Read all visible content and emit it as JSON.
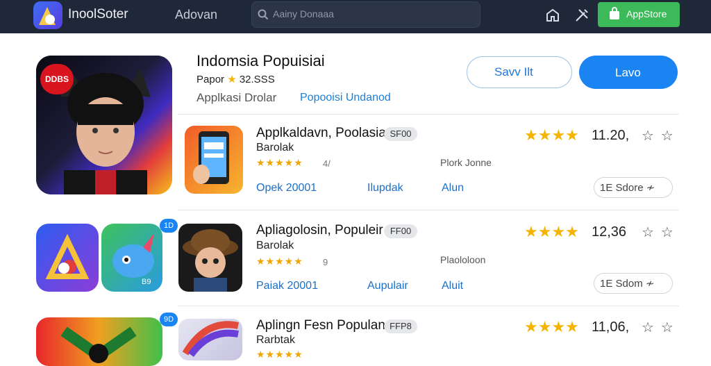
{
  "header": {
    "brand": "InoolSoter",
    "nav_link": "Adovan",
    "search_placeholder": "Aainy Donaaa",
    "appstore_label": "AppStore"
  },
  "hero": {
    "title": "Indomsia Popuisiai",
    "subtitle_prefix": "Papor",
    "subtitle_rating": "32.SSS",
    "category": "Applkasi Drolar",
    "category_link": "Popooisi Undanod",
    "secondary_button": "Savv   Ilt",
    "primary_button": "Lavo",
    "badge_text": "DDBS"
  },
  "list": [
    {
      "title": "Applkaldavn, Poolasia",
      "subtitle": "Barolak",
      "badge": "SF00",
      "mini_stars": "★★★★★",
      "mini_count": "4/",
      "developer": "Plork Jonne",
      "meta_left": "Opek 20001",
      "meta_mid": "Ilupdak",
      "meta_right": "Alun",
      "stars": "★★★★",
      "rating": "11.20,",
      "outline_stars": "☆☆",
      "pill": "1E Sdore ≁"
    },
    {
      "title": "Apliagolosin, Populeir",
      "subtitle": "Barolak",
      "badge": "FF00",
      "mini_stars": "★★★★★",
      "mini_count": "9",
      "developer": "Plaololoon",
      "meta_left": "Paiak 20001",
      "meta_mid": "Aupulair",
      "meta_right": "Aluit",
      "stars": "★★★★",
      "rating": "12,36",
      "outline_stars": "☆☆",
      "pill": "1E Sdom ≁"
    },
    {
      "title": "Aplingn Fesn Populan",
      "subtitle": "Rarbtak",
      "badge": "FFP8",
      "mini_stars": "★★★★★",
      "mini_count": "",
      "developer": "",
      "meta_left": "",
      "meta_mid": "",
      "meta_right": "",
      "stars": "★★★★",
      "rating": "11,06,",
      "outline_stars": "☆☆",
      "pill": ""
    }
  ],
  "side_icons": {
    "badge1": "1D",
    "badge2": "9D",
    "icon2_text": "B9"
  },
  "colors": {
    "topbar": "#1e2838",
    "accent": "#1a84f2",
    "store_green": "#3cba5a",
    "star": "#f5b400"
  }
}
